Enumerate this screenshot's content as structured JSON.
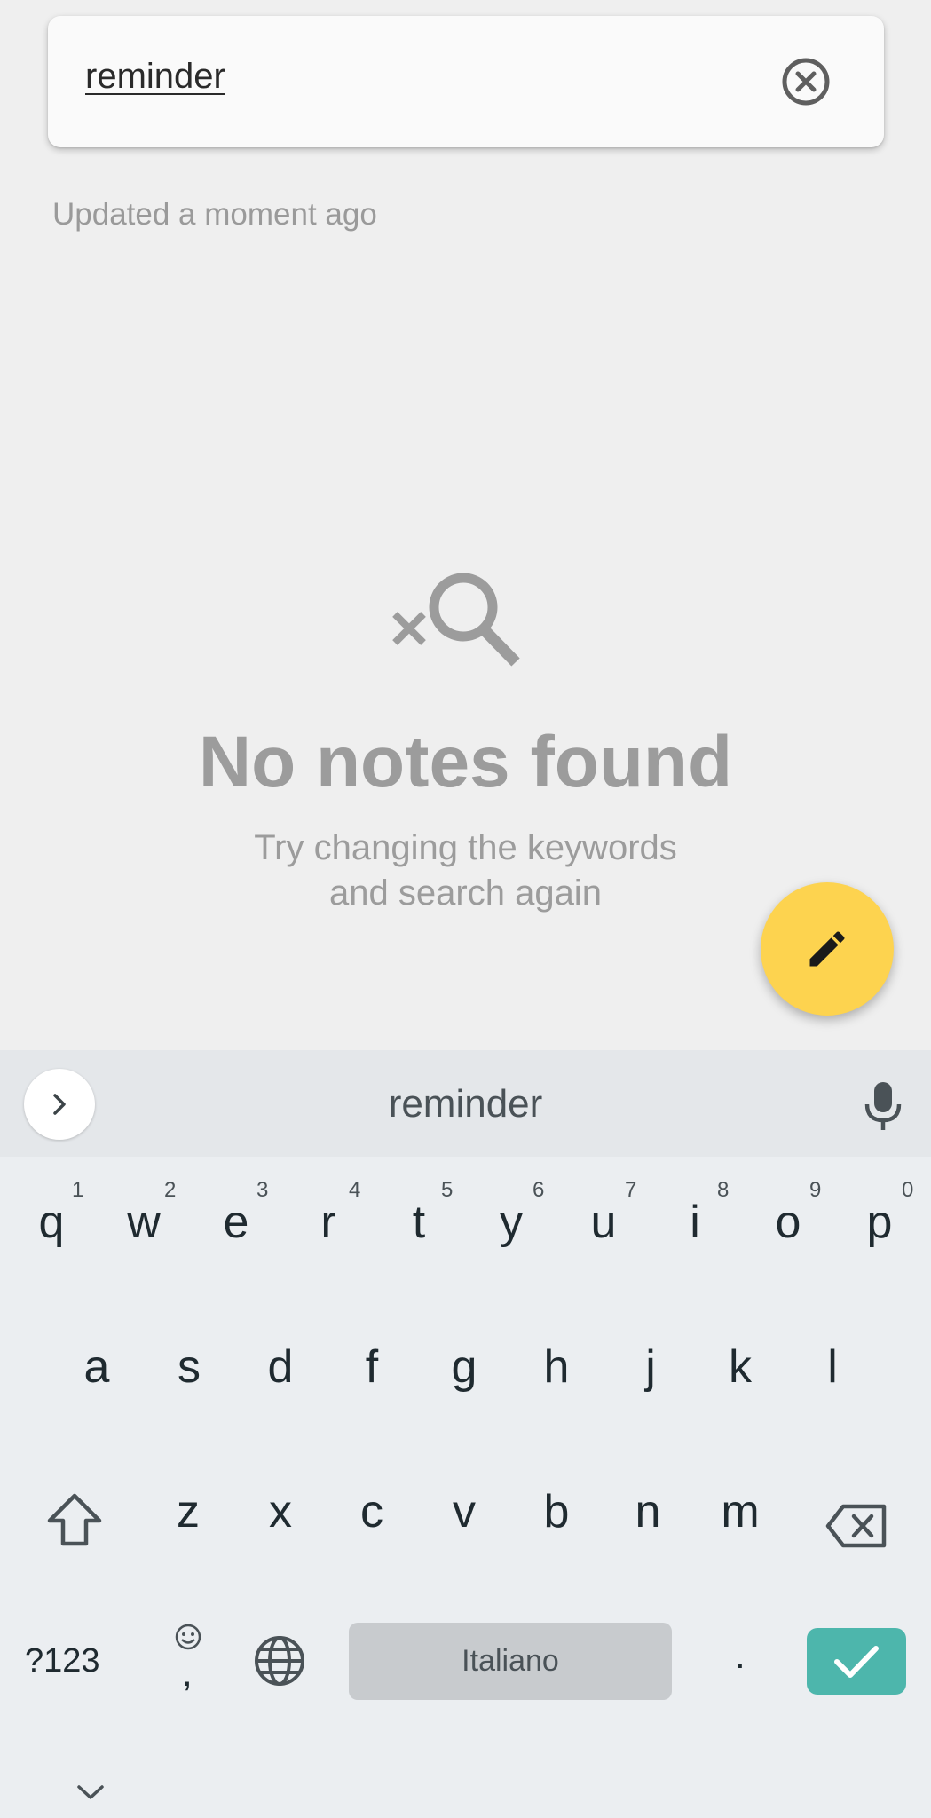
{
  "search": {
    "query": "reminder",
    "clear_icon": "close-circle-icon"
  },
  "status": {
    "updated": "Updated a moment ago"
  },
  "empty_state": {
    "icon": "search-off-icon",
    "title": "No notes found",
    "subtitle_line1": "Try changing the keywords",
    "subtitle_line2": "and search again"
  },
  "fab": {
    "icon": "pencil-icon",
    "color": "#fdd34f"
  },
  "keyboard": {
    "suggestion": "reminder",
    "row1": [
      "q",
      "w",
      "e",
      "r",
      "t",
      "y",
      "u",
      "i",
      "o",
      "p"
    ],
    "row1_hints": [
      "1",
      "2",
      "3",
      "4",
      "5",
      "6",
      "7",
      "8",
      "9",
      "0"
    ],
    "row2": [
      "a",
      "s",
      "d",
      "f",
      "g",
      "h",
      "j",
      "k",
      "l"
    ],
    "row3": [
      "z",
      "x",
      "c",
      "v",
      "b",
      "n",
      "m"
    ],
    "symbols_label": "?123",
    "comma": ",",
    "period": ".",
    "space_label": "Italiano",
    "enter_color": "#4db6ac"
  }
}
